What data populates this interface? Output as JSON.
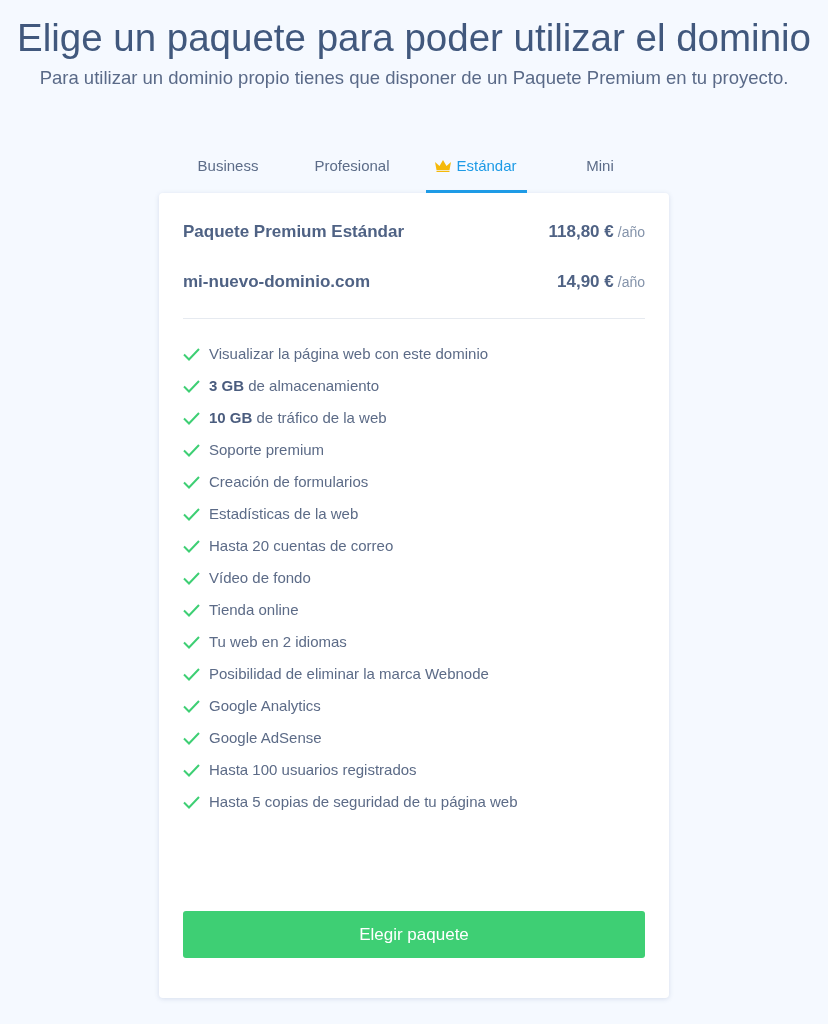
{
  "header": {
    "title": "Elige un paquete para poder utilizar el dominio",
    "subtitle": "Para utilizar un dominio propio tienes que disponer de un Paquete Premium en tu proyecto."
  },
  "tabs": [
    {
      "label": "Business",
      "selected": false,
      "kind": "plain"
    },
    {
      "label": "Profesional",
      "selected": false,
      "kind": "plain"
    },
    {
      "label": "Estándar",
      "selected": true,
      "kind": "crown"
    },
    {
      "label": "Mini",
      "selected": false,
      "kind": "plain"
    }
  ],
  "card": {
    "prices": [
      {
        "name": "Paquete Premium Estándar",
        "price": "118,80 €",
        "period": "/año"
      },
      {
        "name": "mi-nuevo-dominio.com",
        "price": "14,90 €",
        "period": "/año"
      }
    ],
    "features": [
      "Visualizar la página web con este dominio",
      "**3 GB** de almacenamiento",
      "**10 GB** de tráfico de la web",
      "Soporte premium",
      "Creación de formularios",
      "Estadísticas de la web",
      "Hasta 20 cuentas de correo",
      "Vídeo de fondo",
      "Tienda online",
      "Tu web en 2 idiomas",
      "Posibilidad de eliminar la marca Webnode",
      "Google Analytics",
      "Google AdSense",
      "Hasta 100 usuarios registrados",
      "Hasta 5 copias de seguridad de tu página web"
    ],
    "button": "Elegir paquete"
  }
}
